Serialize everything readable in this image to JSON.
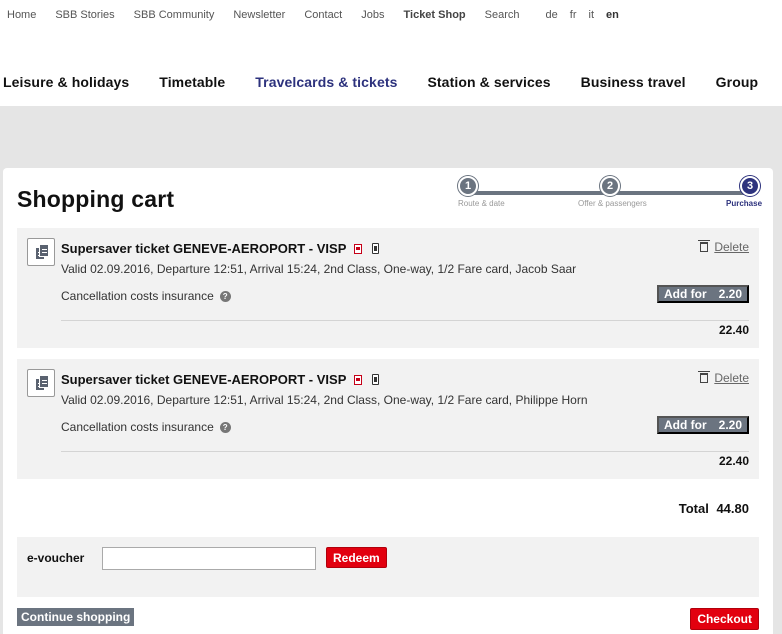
{
  "topnav": {
    "links": [
      "Home",
      "SBB Stories",
      "SBB Community",
      "Newsletter",
      "Contact",
      "Jobs",
      "Ticket Shop",
      "Search"
    ],
    "languages": [
      "de",
      "fr",
      "it",
      "en"
    ],
    "active_language": "en"
  },
  "mainnav": {
    "items": [
      "Leisure & holidays",
      "Timetable",
      "Travelcards & tickets",
      "Station & services",
      "Business travel",
      "Group"
    ],
    "active": "Travelcards & tickets"
  },
  "page": {
    "title": "Shopping cart"
  },
  "stepper": {
    "steps": [
      {
        "number": "1",
        "label": "Route & date"
      },
      {
        "number": "2",
        "label": "Offer & passengers"
      },
      {
        "number": "3",
        "label": "Purchase"
      }
    ],
    "current": 3
  },
  "cart": {
    "items": [
      {
        "title": "Supersaver ticket GENEVE-AEROPORT - VISP",
        "detail": "Valid 02.09.2016, Departure 12:51, Arrival 15:24, 2nd Class, One-way, 1/2 Fare card, Jacob Saar",
        "delete_label": "Delete",
        "insurance_label": "Cancellation costs insurance",
        "help_glyph": "?",
        "addfor_label": "Add for",
        "addfor_amount": "2.20",
        "price": "22.40"
      },
      {
        "title": "Supersaver ticket GENEVE-AEROPORT - VISP",
        "detail": "Valid 02.09.2016, Departure 12:51, Arrival 15:24, 2nd Class, One-way, 1/2 Fare card, Philippe Horn",
        "delete_label": "Delete",
        "insurance_label": "Cancellation costs insurance",
        "help_glyph": "?",
        "addfor_label": "Add for",
        "addfor_amount": "2.20",
        "price": "22.40"
      }
    ],
    "total_label": "Total",
    "total_amount": "44.80"
  },
  "voucher": {
    "label": "e-voucher",
    "value": "",
    "placeholder": "",
    "redeem_label": "Redeem"
  },
  "actions": {
    "continue_label": "Continue shopping",
    "checkout_label": "Checkout"
  },
  "colors": {
    "brand_red": "#e2000f",
    "active_blue": "#2d327d",
    "button_grey": "#6b7480"
  }
}
